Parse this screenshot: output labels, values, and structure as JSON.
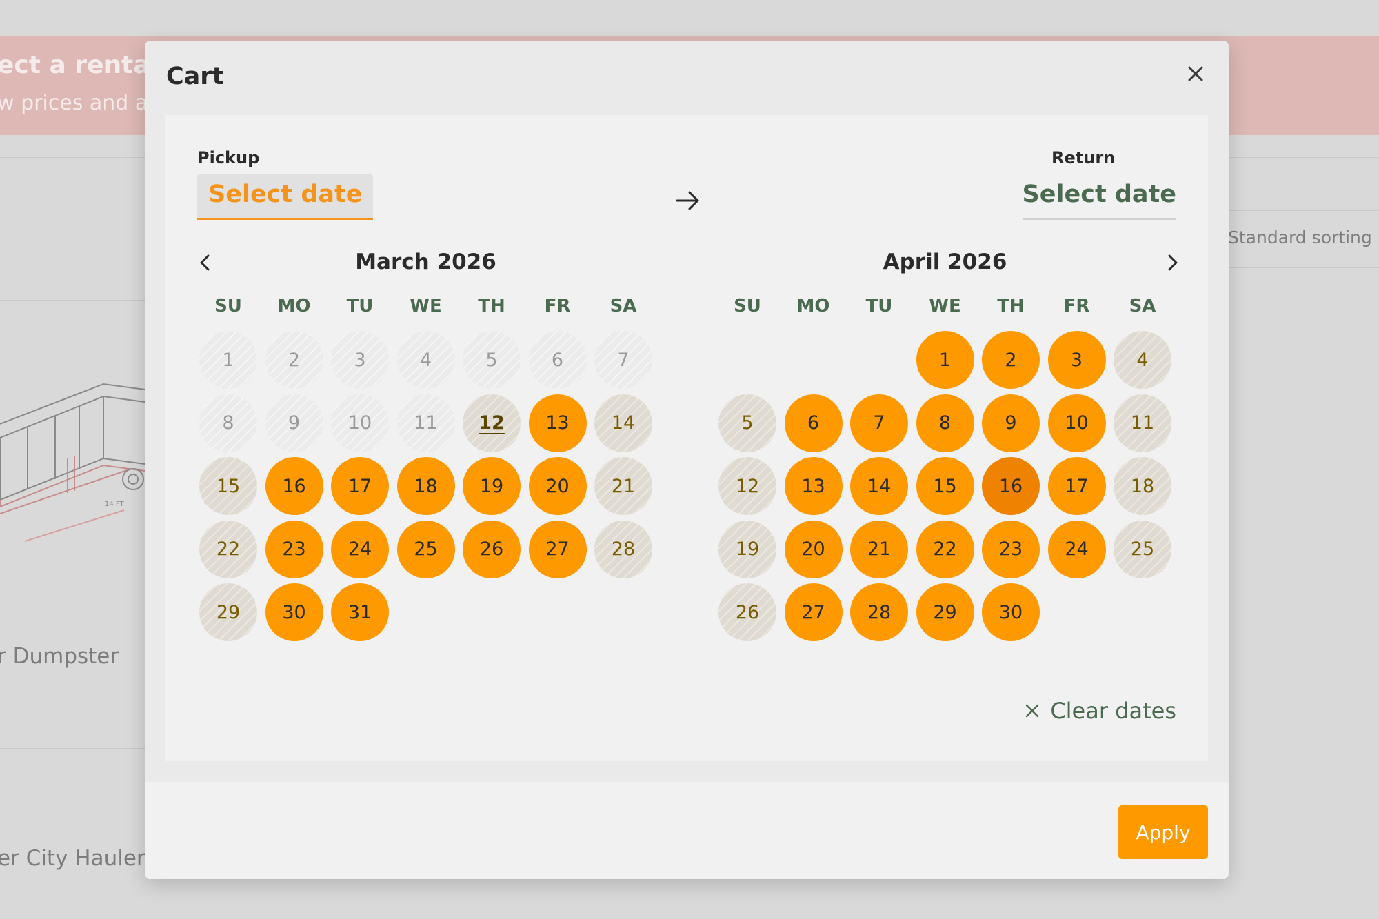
{
  "background": {
    "banner_title": "ect a rental p",
    "banner_subtitle": "w prices and av",
    "sort_label": "Standard sorting",
    "product_name_1": "r Dumpster",
    "product_name_2": "er City Haulers",
    "dimension_label": "14 FT"
  },
  "modal": {
    "title": "Cart",
    "pickup_label": "Pickup",
    "pickup_value": "Select date",
    "return_label": "Return",
    "return_value": "Select date",
    "clear_label": "Clear dates",
    "apply_label": "Apply"
  },
  "calendar": {
    "weekdays": [
      "SU",
      "MO",
      "TU",
      "WE",
      "TH",
      "FR",
      "SA"
    ],
    "months": [
      {
        "title": "March 2026",
        "first_weekday": 0,
        "days": [
          {
            "d": "1",
            "s": "past"
          },
          {
            "d": "2",
            "s": "past"
          },
          {
            "d": "3",
            "s": "past"
          },
          {
            "d": "4",
            "s": "past"
          },
          {
            "d": "5",
            "s": "past"
          },
          {
            "d": "6",
            "s": "past"
          },
          {
            "d": "7",
            "s": "past"
          },
          {
            "d": "8",
            "s": "past"
          },
          {
            "d": "9",
            "s": "past"
          },
          {
            "d": "10",
            "s": "past"
          },
          {
            "d": "11",
            "s": "past"
          },
          {
            "d": "12",
            "s": "today"
          },
          {
            "d": "13",
            "s": "avail"
          },
          {
            "d": "14",
            "s": "unavail"
          },
          {
            "d": "15",
            "s": "unavail"
          },
          {
            "d": "16",
            "s": "avail"
          },
          {
            "d": "17",
            "s": "avail"
          },
          {
            "d": "18",
            "s": "avail"
          },
          {
            "d": "19",
            "s": "avail"
          },
          {
            "d": "20",
            "s": "avail"
          },
          {
            "d": "21",
            "s": "unavail"
          },
          {
            "d": "22",
            "s": "unavail"
          },
          {
            "d": "23",
            "s": "avail"
          },
          {
            "d": "24",
            "s": "avail"
          },
          {
            "d": "25",
            "s": "avail"
          },
          {
            "d": "26",
            "s": "avail"
          },
          {
            "d": "27",
            "s": "avail"
          },
          {
            "d": "28",
            "s": "unavail"
          },
          {
            "d": "29",
            "s": "unavail"
          },
          {
            "d": "30",
            "s": "avail"
          },
          {
            "d": "31",
            "s": "avail"
          }
        ]
      },
      {
        "title": "April 2026",
        "first_weekday": 3,
        "days": [
          {
            "d": "1",
            "s": "avail"
          },
          {
            "d": "2",
            "s": "avail"
          },
          {
            "d": "3",
            "s": "avail"
          },
          {
            "d": "4",
            "s": "unavail"
          },
          {
            "d": "5",
            "s": "unavail"
          },
          {
            "d": "6",
            "s": "avail"
          },
          {
            "d": "7",
            "s": "avail"
          },
          {
            "d": "8",
            "s": "avail"
          },
          {
            "d": "9",
            "s": "avail"
          },
          {
            "d": "10",
            "s": "avail"
          },
          {
            "d": "11",
            "s": "unavail"
          },
          {
            "d": "12",
            "s": "unavail"
          },
          {
            "d": "13",
            "s": "avail"
          },
          {
            "d": "14",
            "s": "avail"
          },
          {
            "d": "15",
            "s": "avail"
          },
          {
            "d": "16",
            "s": "hover"
          },
          {
            "d": "17",
            "s": "avail"
          },
          {
            "d": "18",
            "s": "unavail"
          },
          {
            "d": "19",
            "s": "unavail"
          },
          {
            "d": "20",
            "s": "avail"
          },
          {
            "d": "21",
            "s": "avail"
          },
          {
            "d": "22",
            "s": "avail"
          },
          {
            "d": "23",
            "s": "avail"
          },
          {
            "d": "24",
            "s": "avail"
          },
          {
            "d": "25",
            "s": "unavail"
          },
          {
            "d": "26",
            "s": "unavail"
          },
          {
            "d": "27",
            "s": "avail"
          },
          {
            "d": "28",
            "s": "avail"
          },
          {
            "d": "29",
            "s": "avail"
          },
          {
            "d": "30",
            "s": "avail"
          }
        ]
      }
    ]
  },
  "colors": {
    "accent": "#ff9900",
    "accent_hover": "#ef8300",
    "green_text": "#4b6b50",
    "overlay": "#d9d9d9"
  },
  "icons": {
    "close": "close-icon",
    "arrow": "arrow-right-icon",
    "prev": "chevron-left-icon",
    "next": "chevron-right-icon",
    "clear": "x-icon"
  }
}
